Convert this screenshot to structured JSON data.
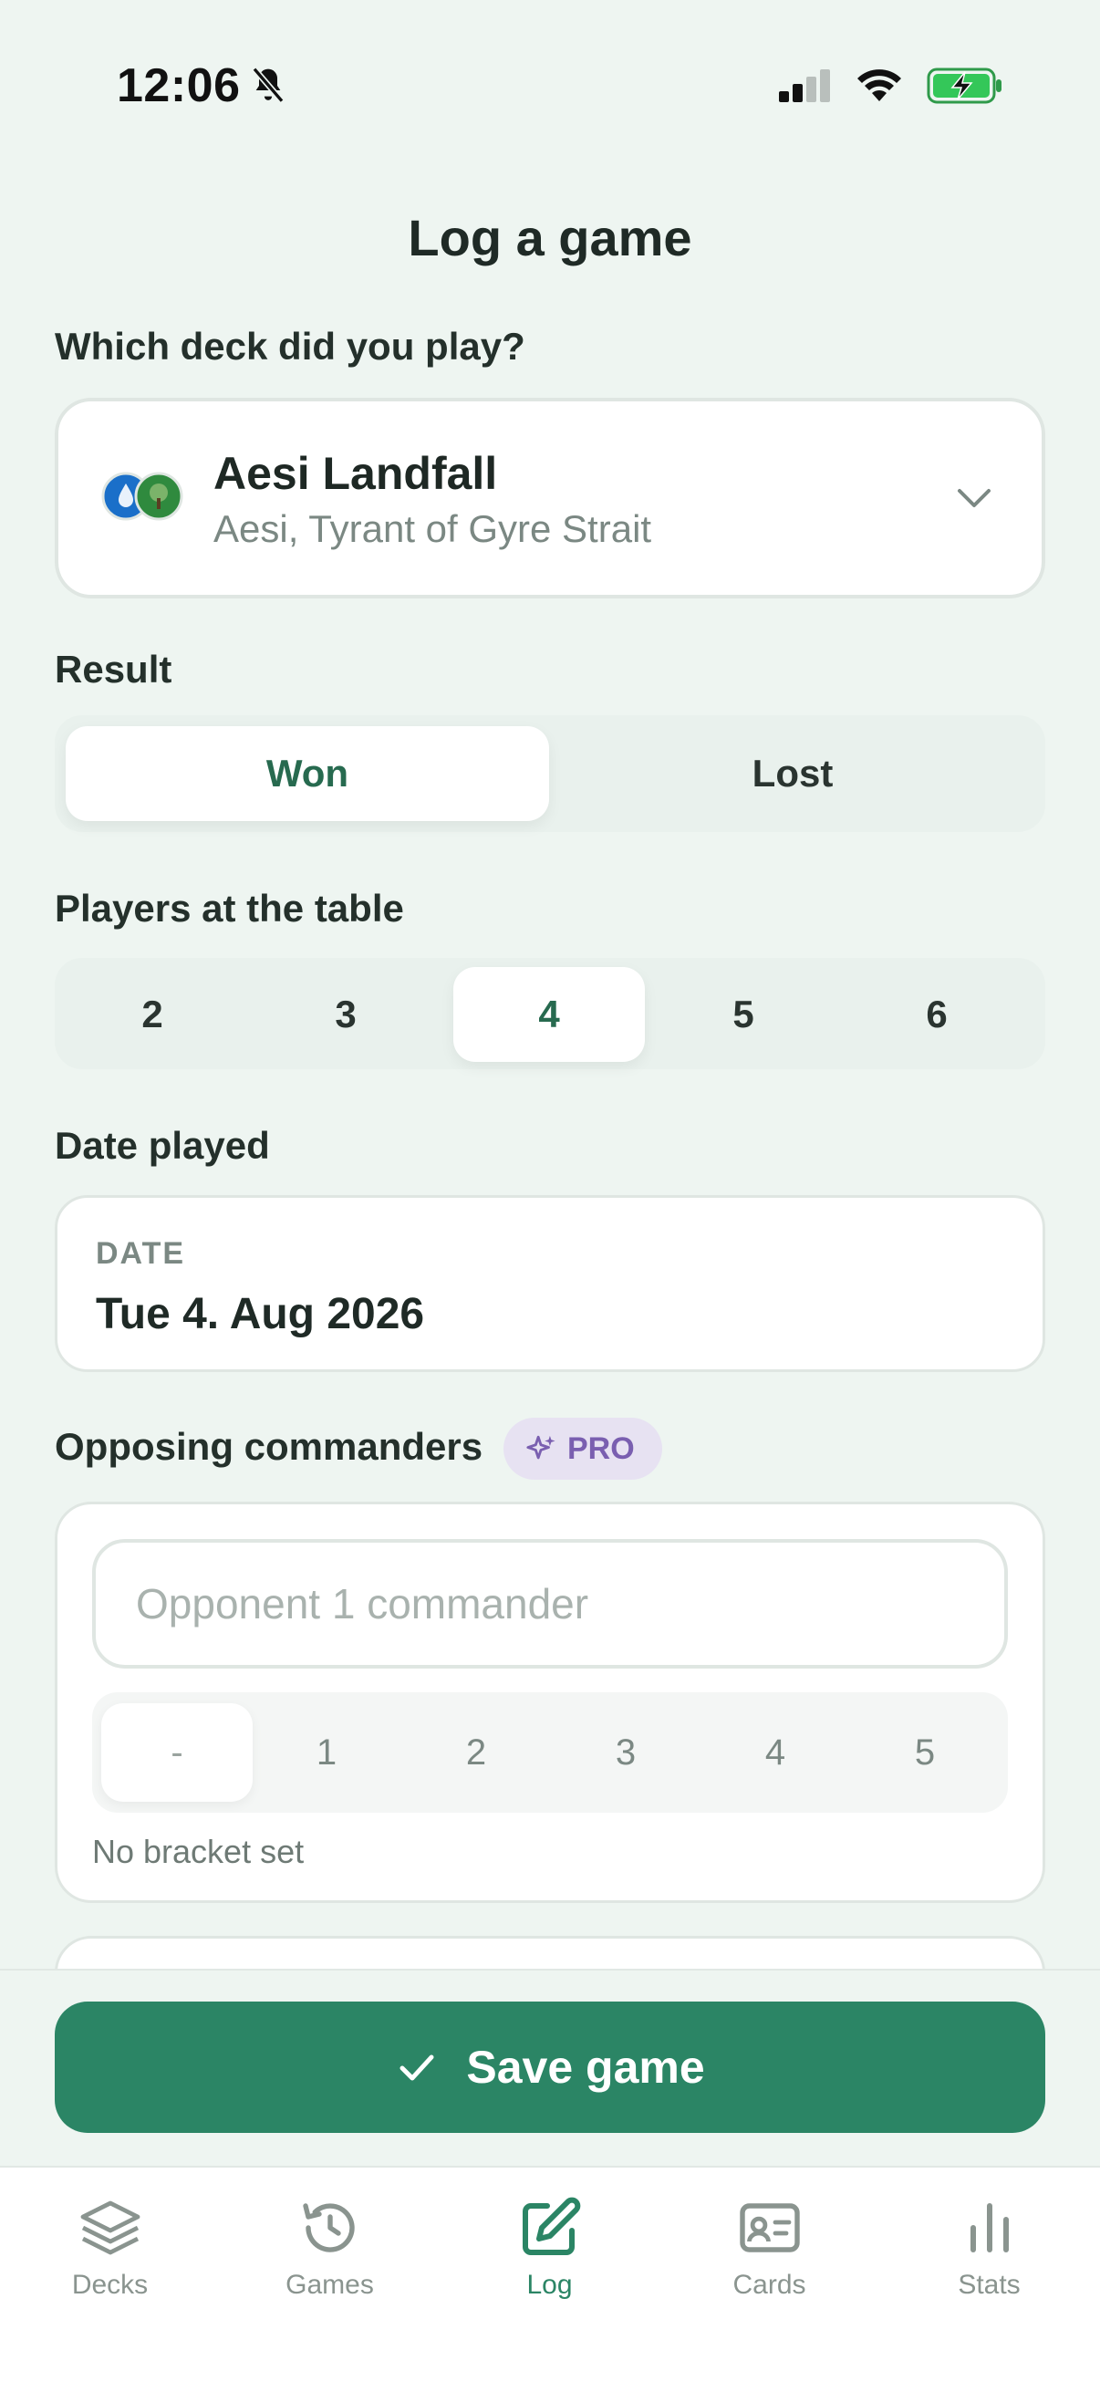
{
  "status": {
    "time": "12:06"
  },
  "title": "Log a game",
  "deck_section": {
    "label": "Which deck did you play?",
    "deck_name": "Aesi Landfall",
    "commander": "Aesi, Tyrant of Gyre Strait"
  },
  "result": {
    "label": "Result",
    "won": "Won",
    "lost": "Lost",
    "selected": "Won"
  },
  "players": {
    "label": "Players at the table",
    "options": [
      "2",
      "3",
      "4",
      "5",
      "6"
    ],
    "selected": "4"
  },
  "date": {
    "label": "Date played",
    "caption": "DATE",
    "value": "Tue 4. Aug 2026"
  },
  "opposing": {
    "label": "Opposing commanders",
    "badge": "PRO",
    "placeholder": "Opponent 1 commander",
    "brackets": [
      "-",
      "1",
      "2",
      "3",
      "4",
      "5"
    ],
    "note": "No bracket set"
  },
  "save_label": "Save game",
  "tabs": [
    {
      "label": "Decks",
      "icon": "layers-icon"
    },
    {
      "label": "Games",
      "icon": "history-icon"
    },
    {
      "label": "Log",
      "icon": "edit-icon",
      "active": true
    },
    {
      "label": "Cards",
      "icon": "id-card-icon"
    },
    {
      "label": "Stats",
      "icon": "bar-chart-icon"
    }
  ],
  "colors": {
    "accent": "#2b8565",
    "background": "#eef5f1",
    "pro": "#7a5fb0"
  }
}
